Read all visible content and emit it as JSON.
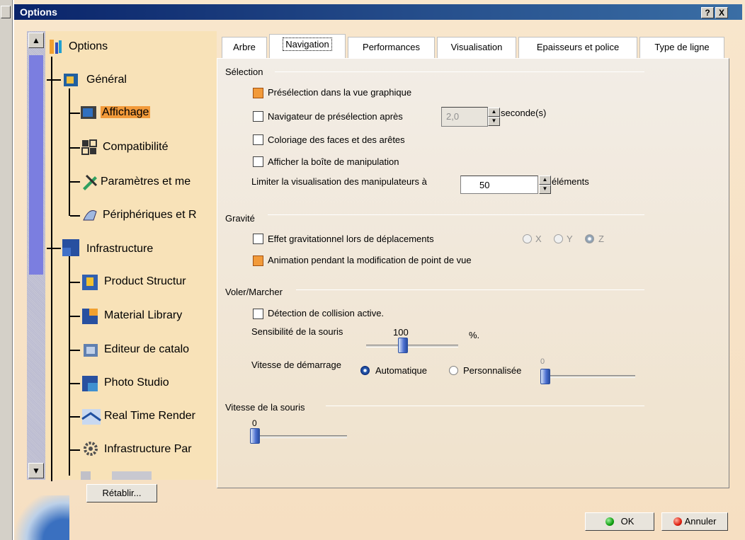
{
  "window": {
    "title": "Options",
    "help_label": "?",
    "close_label": "X"
  },
  "tree": {
    "root": "Options",
    "items": [
      {
        "label": "Général"
      },
      {
        "label": "Affichage"
      },
      {
        "label": "Compatibilité"
      },
      {
        "label": "Paramètres et me"
      },
      {
        "label": "Périphériques et R"
      },
      {
        "label": "Infrastructure"
      },
      {
        "label": "Product Structur"
      },
      {
        "label": "Material Library"
      },
      {
        "label": "Editeur de catalo"
      },
      {
        "label": "Photo Studio"
      },
      {
        "label": "Real Time Render"
      },
      {
        "label": "Infrastructure Par"
      }
    ]
  },
  "tabs": [
    {
      "label": "Arbre"
    },
    {
      "label": "Navigation"
    },
    {
      "label": "Performances"
    },
    {
      "label": "Visualisation"
    },
    {
      "label": "Epaisseurs et police"
    },
    {
      "label": "Type de ligne"
    }
  ],
  "selection": {
    "title": "Sélection",
    "preselection_label": "Présélection dans la vue graphique",
    "navigator_label": "Navigateur de présélection après",
    "navigator_value": "2,0",
    "navigator_unit": "seconde(s)",
    "coloring_label": "Coloriage des faces et des arêtes",
    "manip_box_label": "Afficher la boîte de manipulation",
    "limit_label": "Limiter la visualisation des manipulateurs à",
    "limit_value": "50",
    "limit_unit": "éléments"
  },
  "gravity": {
    "title": "Gravité",
    "effect_label": "Effet gravitationnel lors de déplacements",
    "axis_x": "X",
    "axis_y": "Y",
    "axis_z": "Z",
    "animation_label": "Animation pendant la modification de point de vue"
  },
  "fly": {
    "title": "Voler/Marcher",
    "collision_label": "Détection de collision active.",
    "sensitivity_label": "Sensibilité de la souris",
    "sensitivity_value": "100",
    "sensitivity_unit": "%.",
    "speed_label": "Vitesse de démarrage",
    "auto_label": "Automatique",
    "custom_label": "Personnalisée",
    "custom_value": "0"
  },
  "mouse": {
    "title": "Vitesse de la souris",
    "value": "0"
  },
  "buttons": {
    "reset": "Rétablir...",
    "ok": "OK",
    "cancel": "Annuler"
  }
}
